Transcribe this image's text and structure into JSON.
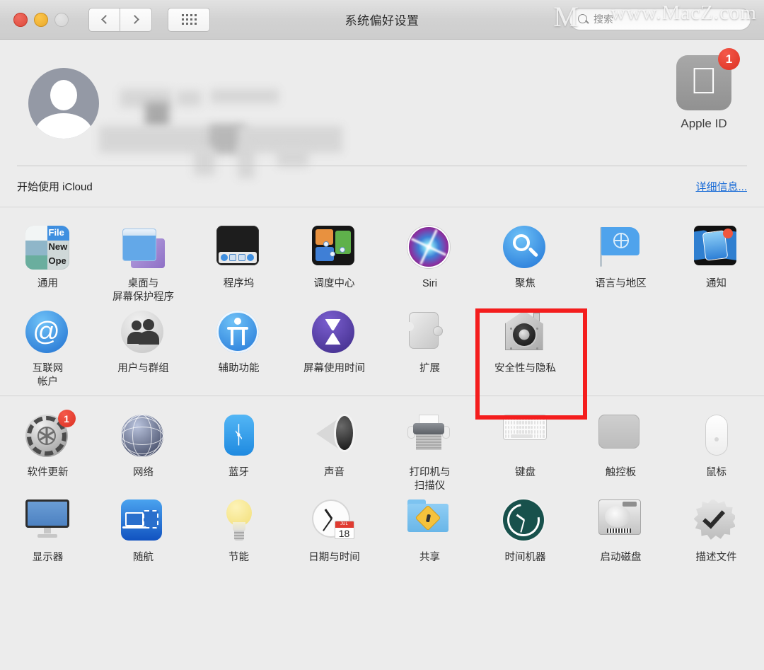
{
  "titlebar": {
    "title": "系统偏好设置",
    "back_label": "‹",
    "forward_label": "›",
    "grid_label": "显示全部",
    "search_placeholder": "搜索",
    "watermark": "www.MacZ.com",
    "watermark_logo": "M"
  },
  "account": {
    "apple_id_label": "Apple ID",
    "apple_id_badge": "1",
    "name_redacted": true
  },
  "icloud": {
    "text": "开始使用 iCloud",
    "link": "详细信息..."
  },
  "highlight": {
    "color": "#f41d1d",
    "target": "安全性与隐私"
  },
  "sections": [
    {
      "id": "personal",
      "items": [
        {
          "label": "通用",
          "icon": "general-icon"
        },
        {
          "label": "桌面与\n屏幕保护程序",
          "icon": "desktop-screensaver-icon"
        },
        {
          "label": "程序坞",
          "icon": "dock-icon"
        },
        {
          "label": "调度中心",
          "icon": "mission-control-icon"
        },
        {
          "label": "Siri",
          "icon": "siri-icon"
        },
        {
          "label": "聚焦",
          "icon": "spotlight-icon"
        },
        {
          "label": "语言与地区",
          "icon": "language-region-icon"
        },
        {
          "label": "通知",
          "icon": "notifications-icon"
        },
        {
          "label": "互联网\n帐户",
          "icon": "internet-accounts-icon"
        },
        {
          "label": "用户与群组",
          "icon": "users-groups-icon"
        },
        {
          "label": "辅助功能",
          "icon": "accessibility-icon"
        },
        {
          "label": "屏幕使用时间",
          "icon": "screen-time-icon"
        },
        {
          "label": "扩展",
          "icon": "extensions-icon"
        },
        {
          "label": "安全性与隐私",
          "icon": "security-privacy-icon"
        }
      ]
    },
    {
      "id": "hardware",
      "items": [
        {
          "label": "软件更新",
          "icon": "software-update-icon",
          "badge": "1"
        },
        {
          "label": "网络",
          "icon": "network-icon"
        },
        {
          "label": "蓝牙",
          "icon": "bluetooth-icon"
        },
        {
          "label": "声音",
          "icon": "sound-icon"
        },
        {
          "label": "打印机与\n扫描仪",
          "icon": "printers-scanners-icon"
        },
        {
          "label": "键盘",
          "icon": "keyboard-icon"
        },
        {
          "label": "触控板",
          "icon": "trackpad-icon"
        },
        {
          "label": "鼠标",
          "icon": "mouse-icon"
        },
        {
          "label": "显示器",
          "icon": "displays-icon"
        },
        {
          "label": "随航",
          "icon": "sidecar-icon"
        },
        {
          "label": "节能",
          "icon": "energy-saver-icon"
        },
        {
          "label": "日期与时间",
          "icon": "date-time-icon"
        },
        {
          "label": "共享",
          "icon": "sharing-icon"
        },
        {
          "label": "时间机器",
          "icon": "time-machine-icon"
        },
        {
          "label": "启动磁盘",
          "icon": "startup-disk-icon"
        },
        {
          "label": "描述文件",
          "icon": "profiles-icon"
        }
      ]
    }
  ],
  "date_icon": {
    "month": "JUL",
    "day": "18"
  },
  "general_icon_text": {
    "line1": "File",
    "line2": "New",
    "line3": "Ope"
  },
  "colors": {
    "accent_blue": "#1569d6",
    "badge_red": "#dc3022",
    "highlight_red": "#f41d1d",
    "window_bg": "#ececec",
    "titlebar_bg": "#d2d2d2"
  }
}
